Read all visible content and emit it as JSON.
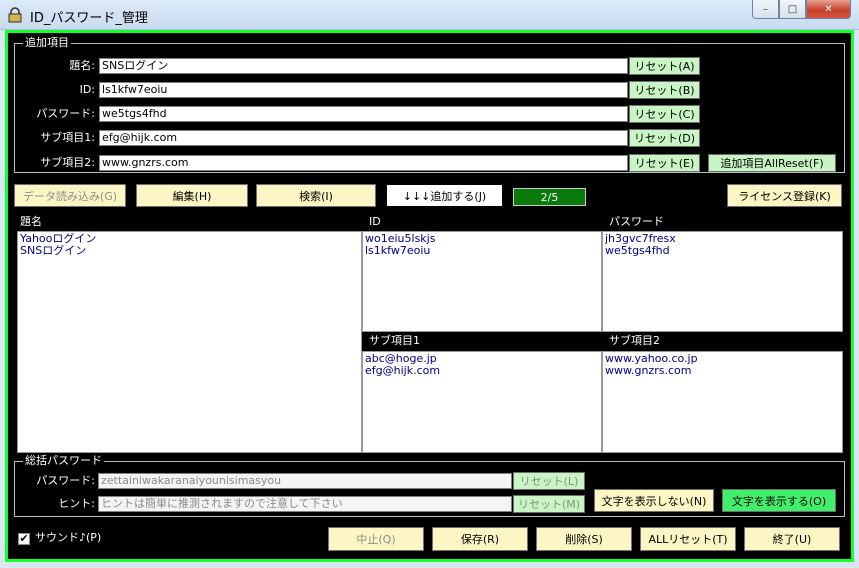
{
  "window": {
    "title": "ID_パスワード_管理",
    "minimize": "–",
    "maximize": "□",
    "close": "✕"
  },
  "add_group": {
    "title": "追加項目",
    "rows": [
      {
        "label": "題名:",
        "value": "SNSログイン",
        "reset": "リセット(A)"
      },
      {
        "label": "ID:",
        "value": "ls1kfw7eoiu",
        "reset": "リセット(B)"
      },
      {
        "label": "パスワード:",
        "value": "we5tgs4fhd",
        "reset": "リセット(C)"
      },
      {
        "label": "サブ項目1:",
        "value": "efg@hijk.com",
        "reset": "リセット(D)"
      },
      {
        "label": "サブ項目2:",
        "value": "www.gnzrs.com",
        "reset": "リセット(E)"
      }
    ],
    "all_reset": "追加項目AllReset(F)"
  },
  "toolbar": {
    "load": "データ読み込み(G)",
    "edit": "編集(H)",
    "search": "検索(I)",
    "add": "↓↓↓追加する(J)",
    "counter": "2/5",
    "license": "ライセンス登録(K)"
  },
  "lists": {
    "title_header": "題名",
    "id_header": "ID",
    "password_header": "パスワード",
    "sub1_header": "サブ項目1",
    "sub2_header": "サブ項目2",
    "titles": [
      "Yahooログイン",
      "SNSログイン"
    ],
    "ids": [
      "wo1eiu5lskjs",
      "ls1kfw7eoiu"
    ],
    "passwords": [
      "jh3gvc7fresx",
      "we5tgs4fhd"
    ],
    "sub1": [
      "abc@hoge.jp",
      "efg@hijk.com"
    ],
    "sub2": [
      "www.yahoo.co.jp",
      "www.gnzrs.com"
    ]
  },
  "master_group": {
    "title": "総括パスワード",
    "password_label": "パスワード:",
    "password_value": "zettainiwakaranaiyounisimasyou",
    "password_reset": "リセット(L)",
    "hint_label": "ヒント:",
    "hint_value": "ヒントは簡単に推測されますので注意して下さい",
    "hint_reset": "リセット(M)",
    "hide_text": "文字を表示しない(N)",
    "show_text": "文字を表示する(O)"
  },
  "footer": {
    "sound_checked": "✔",
    "sound_label": "サウンド♪(P)",
    "cancel": "中止(Q)",
    "save": "保存(R)",
    "delete": "削除(S)",
    "all_reset": "ALLリセット(T)",
    "exit": "終了(U)"
  },
  "colors": {
    "frame": "#15ff2a",
    "list_text": "#00008b",
    "counter_bg": "#0a7a0a"
  }
}
